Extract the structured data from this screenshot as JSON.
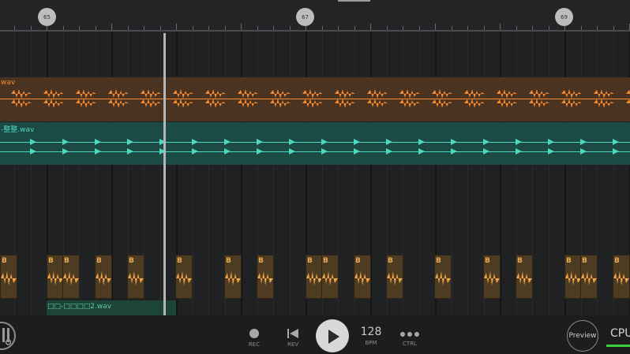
{
  "ruler": {
    "markers": [
      "65",
      "67",
      "69"
    ]
  },
  "tracks": {
    "orange_track": {
      "label": "wav",
      "color": "#fb8c2e",
      "bg": "#4b3322"
    },
    "teal_track": {
      "label": "-整整.wav",
      "color": "#4ed7c1",
      "bg": "#1c4a45"
    },
    "beat_clips": {
      "label": "B..."
    },
    "green_clip": {
      "label": "□□-□□□□2.wav"
    }
  },
  "transport": {
    "rec_label": "REC",
    "rev_label": "REV",
    "bpm_value": "128",
    "bpm_label": "BPM",
    "ctrl_label": "CTRL",
    "preview_label": "Preview",
    "cpu_label": "CPU"
  }
}
